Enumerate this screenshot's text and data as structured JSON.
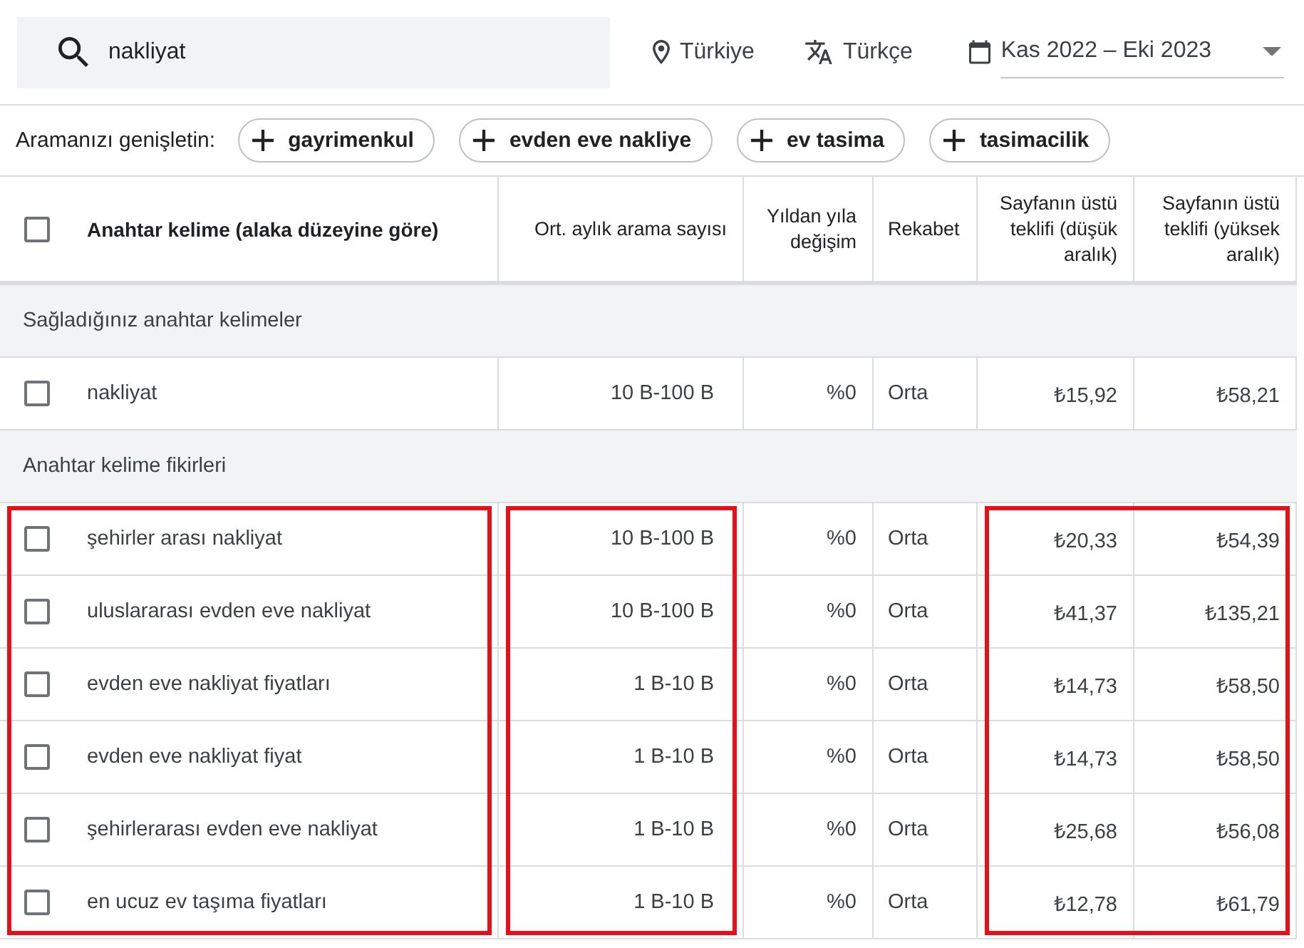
{
  "search": {
    "value": "nakliyat"
  },
  "filters": [
    {
      "kind": "location",
      "label": "Türkiye"
    },
    {
      "kind": "language",
      "label": "Türkçe"
    },
    {
      "kind": "date_range",
      "label": "Kas 2022 – Eki 2023"
    }
  ],
  "broaden": {
    "label": "Aramanızı genişletin:",
    "chips": [
      "gayrimenkul",
      "evden eve nakliye",
      "ev tasima",
      "tasimacilik"
    ]
  },
  "table": {
    "select_all_checked": false,
    "columns": [
      {
        "kind": "keyword",
        "label": "Anahtar kelime (alaka düzeyine göre)",
        "sorted": true,
        "highlighted": true,
        "highlight_joined": false
      },
      {
        "kind": "range",
        "label": "Ort. aylık arama sayısı",
        "sorted": false,
        "highlighted": true,
        "highlight_joined": false
      },
      {
        "kind": "percent",
        "label": "Yıldan yıla değişim",
        "sorted": false,
        "highlighted": false,
        "highlight_joined": false
      },
      {
        "kind": "level",
        "label": "Rekabet",
        "sorted": false,
        "highlighted": false,
        "highlight_joined": false
      },
      {
        "kind": "currency",
        "label": "Sayfanın üstü teklifi (düşük aralık)",
        "sorted": false,
        "highlighted": true,
        "highlight_joined": false
      },
      {
        "kind": "currency",
        "label": "Sayfanın üstü teklifi (yüksek aralık)",
        "sorted": false,
        "highlighted": true,
        "highlight_joined": true
      }
    ],
    "groups": [
      {
        "title": "Sağladığınız anahtar kelimeler",
        "highlighted": false,
        "rows": [
          {
            "checked": false,
            "cells": [
              "nakliyat",
              "10 B-100 B",
              "%0",
              "Orta",
              "₺15,92",
              "₺58,21"
            ]
          }
        ]
      },
      {
        "title": "Anahtar kelime fikirleri",
        "highlighted": true,
        "rows": [
          {
            "checked": false,
            "cells": [
              "şehirler arası nakliyat",
              "10 B-100 B",
              "%0",
              "Orta",
              "₺20,33",
              "₺54,39"
            ]
          },
          {
            "checked": false,
            "cells": [
              "uluslararası evden eve nakliyat",
              "10 B-100 B",
              "%0",
              "Orta",
              "₺41,37",
              "₺135,21"
            ]
          },
          {
            "checked": false,
            "cells": [
              "evden eve nakliyat fiyatları",
              "1 B-10 B",
              "%0",
              "Orta",
              "₺14,73",
              "₺58,50"
            ]
          },
          {
            "checked": false,
            "cells": [
              "evden eve nakliyat fiyat",
              "1 B-10 B",
              "%0",
              "Orta",
              "₺14,73",
              "₺58,50"
            ]
          },
          {
            "checked": false,
            "cells": [
              "şehirlerarası evden eve nakliyat",
              "1 B-10 B",
              "%0",
              "Orta",
              "₺25,68",
              "₺56,08"
            ]
          },
          {
            "checked": false,
            "cells": [
              "en ucuz ev taşıma fiyatları",
              "1 B-10 B",
              "%0",
              "Orta",
              "₺12,78",
              "₺61,79"
            ]
          }
        ]
      }
    ]
  }
}
